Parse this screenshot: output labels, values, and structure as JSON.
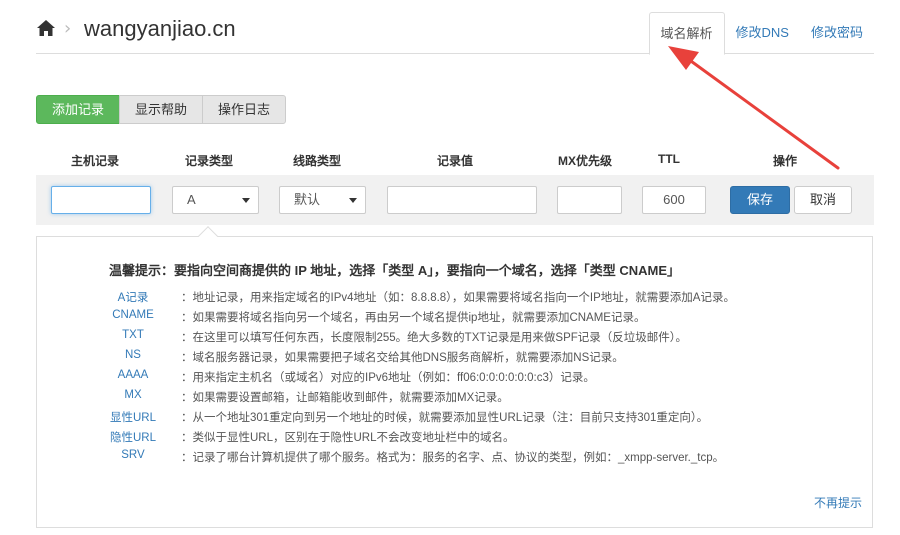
{
  "header": {
    "home_icon": "home-icon",
    "separator": "›",
    "site_title": "wangyanjiao.cn",
    "tabs": [
      {
        "label": "域名解析",
        "active": true
      },
      {
        "label": "修改DNS",
        "active": false
      },
      {
        "label": "修改密码",
        "active": false
      }
    ]
  },
  "actions": {
    "add_record": "添加记录",
    "show_help": "显示帮助",
    "operation_log": "操作日志"
  },
  "table": {
    "headers": [
      "主机记录",
      "记录类型",
      "线路类型",
      "记录值",
      "MX优先级",
      "TTL",
      "操作"
    ]
  },
  "form": {
    "host_value": "",
    "type_selected": "A",
    "line_selected": "默认",
    "record_value": "",
    "mx_value": "",
    "ttl_value": "600",
    "save_label": "保存",
    "cancel_label": "取消"
  },
  "tips": {
    "title": "温馨提示：要指向空间商提供的 IP 地址，选择「类型 A」，要指向一个域名，选择「类型 CNAME」",
    "rows": [
      {
        "type": "A记录",
        "desc": "：地址记录，用来指定域名的IPv4地址（如：8.8.8.8），如果需要将域名指向一个IP地址，就需要添加A记录。"
      },
      {
        "type": "CNAME",
        "desc": "：如果需要将域名指向另一个域名，再由另一个域名提供ip地址，就需要添加CNAME记录。"
      },
      {
        "type": "TXT",
        "desc": "：在这里可以填写任何东西，长度限制255。绝大多数的TXT记录是用来做SPF记录（反垃圾邮件）。"
      },
      {
        "type": "NS",
        "desc": "：域名服务器记录，如果需要把子域名交给其他DNS服务商解析，就需要添加NS记录。"
      },
      {
        "type": "AAAA",
        "desc": "：用来指定主机名（或域名）对应的IPv6地址（例如：ff06:0:0:0:0:0:0:c3）记录。"
      },
      {
        "type": "MX",
        "desc": "：如果需要设置邮箱，让邮箱能收到邮件，就需要添加MX记录。"
      },
      {
        "type": "显性URL",
        "desc": "：从一个地址301重定向到另一个地址的时候，就需要添加显性URL记录（注：目前只支持301重定向）。"
      },
      {
        "type": "隐性URL",
        "desc": "：类似于显性URL，区别在于隐性URL不会改变地址栏中的域名。"
      },
      {
        "type": "SRV",
        "desc": "：记录了哪台计算机提供了哪个服务。格式为：服务的名字、点、协议的类型，例如：_xmpp-server._tcp。"
      }
    ],
    "dismiss": "不再提示"
  },
  "colors": {
    "primary": "#337ab7",
    "success": "#5cb85c",
    "annotation_arrow": "#e8413b"
  }
}
